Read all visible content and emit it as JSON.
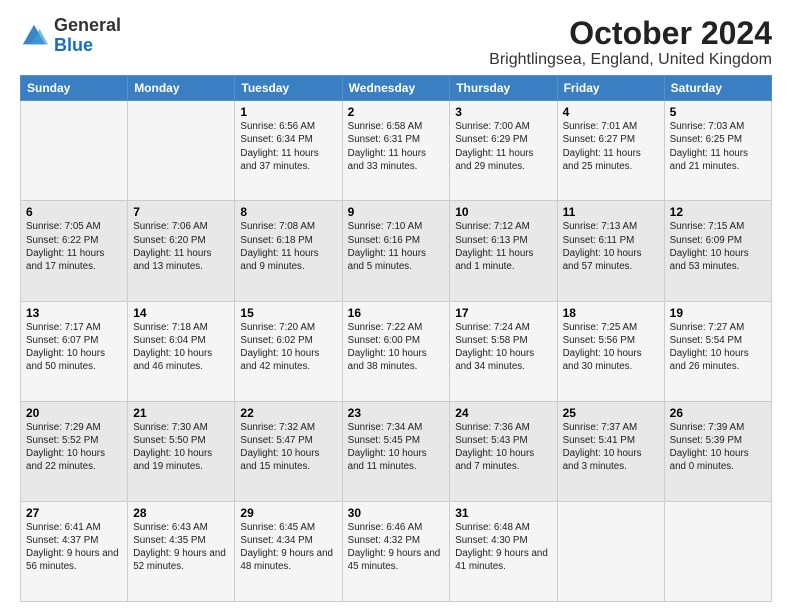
{
  "logo": {
    "general": "General",
    "blue": "Blue"
  },
  "header": {
    "title": "October 2024",
    "subtitle": "Brightlingsea, England, United Kingdom"
  },
  "weekdays": [
    "Sunday",
    "Monday",
    "Tuesday",
    "Wednesday",
    "Thursday",
    "Friday",
    "Saturday"
  ],
  "weeks": [
    [
      {
        "day": "",
        "info": ""
      },
      {
        "day": "",
        "info": ""
      },
      {
        "day": "1",
        "info": "Sunrise: 6:56 AM\nSunset: 6:34 PM\nDaylight: 11 hours and 37 minutes."
      },
      {
        "day": "2",
        "info": "Sunrise: 6:58 AM\nSunset: 6:31 PM\nDaylight: 11 hours and 33 minutes."
      },
      {
        "day": "3",
        "info": "Sunrise: 7:00 AM\nSunset: 6:29 PM\nDaylight: 11 hours and 29 minutes."
      },
      {
        "day": "4",
        "info": "Sunrise: 7:01 AM\nSunset: 6:27 PM\nDaylight: 11 hours and 25 minutes."
      },
      {
        "day": "5",
        "info": "Sunrise: 7:03 AM\nSunset: 6:25 PM\nDaylight: 11 hours and 21 minutes."
      }
    ],
    [
      {
        "day": "6",
        "info": "Sunrise: 7:05 AM\nSunset: 6:22 PM\nDaylight: 11 hours and 17 minutes."
      },
      {
        "day": "7",
        "info": "Sunrise: 7:06 AM\nSunset: 6:20 PM\nDaylight: 11 hours and 13 minutes."
      },
      {
        "day": "8",
        "info": "Sunrise: 7:08 AM\nSunset: 6:18 PM\nDaylight: 11 hours and 9 minutes."
      },
      {
        "day": "9",
        "info": "Sunrise: 7:10 AM\nSunset: 6:16 PM\nDaylight: 11 hours and 5 minutes."
      },
      {
        "day": "10",
        "info": "Sunrise: 7:12 AM\nSunset: 6:13 PM\nDaylight: 11 hours and 1 minute."
      },
      {
        "day": "11",
        "info": "Sunrise: 7:13 AM\nSunset: 6:11 PM\nDaylight: 10 hours and 57 minutes."
      },
      {
        "day": "12",
        "info": "Sunrise: 7:15 AM\nSunset: 6:09 PM\nDaylight: 10 hours and 53 minutes."
      }
    ],
    [
      {
        "day": "13",
        "info": "Sunrise: 7:17 AM\nSunset: 6:07 PM\nDaylight: 10 hours and 50 minutes."
      },
      {
        "day": "14",
        "info": "Sunrise: 7:18 AM\nSunset: 6:04 PM\nDaylight: 10 hours and 46 minutes."
      },
      {
        "day": "15",
        "info": "Sunrise: 7:20 AM\nSunset: 6:02 PM\nDaylight: 10 hours and 42 minutes."
      },
      {
        "day": "16",
        "info": "Sunrise: 7:22 AM\nSunset: 6:00 PM\nDaylight: 10 hours and 38 minutes."
      },
      {
        "day": "17",
        "info": "Sunrise: 7:24 AM\nSunset: 5:58 PM\nDaylight: 10 hours and 34 minutes."
      },
      {
        "day": "18",
        "info": "Sunrise: 7:25 AM\nSunset: 5:56 PM\nDaylight: 10 hours and 30 minutes."
      },
      {
        "day": "19",
        "info": "Sunrise: 7:27 AM\nSunset: 5:54 PM\nDaylight: 10 hours and 26 minutes."
      }
    ],
    [
      {
        "day": "20",
        "info": "Sunrise: 7:29 AM\nSunset: 5:52 PM\nDaylight: 10 hours and 22 minutes."
      },
      {
        "day": "21",
        "info": "Sunrise: 7:30 AM\nSunset: 5:50 PM\nDaylight: 10 hours and 19 minutes."
      },
      {
        "day": "22",
        "info": "Sunrise: 7:32 AM\nSunset: 5:47 PM\nDaylight: 10 hours and 15 minutes."
      },
      {
        "day": "23",
        "info": "Sunrise: 7:34 AM\nSunset: 5:45 PM\nDaylight: 10 hours and 11 minutes."
      },
      {
        "day": "24",
        "info": "Sunrise: 7:36 AM\nSunset: 5:43 PM\nDaylight: 10 hours and 7 minutes."
      },
      {
        "day": "25",
        "info": "Sunrise: 7:37 AM\nSunset: 5:41 PM\nDaylight: 10 hours and 3 minutes."
      },
      {
        "day": "26",
        "info": "Sunrise: 7:39 AM\nSunset: 5:39 PM\nDaylight: 10 hours and 0 minutes."
      }
    ],
    [
      {
        "day": "27",
        "info": "Sunrise: 6:41 AM\nSunset: 4:37 PM\nDaylight: 9 hours and 56 minutes."
      },
      {
        "day": "28",
        "info": "Sunrise: 6:43 AM\nSunset: 4:35 PM\nDaylight: 9 hours and 52 minutes."
      },
      {
        "day": "29",
        "info": "Sunrise: 6:45 AM\nSunset: 4:34 PM\nDaylight: 9 hours and 48 minutes."
      },
      {
        "day": "30",
        "info": "Sunrise: 6:46 AM\nSunset: 4:32 PM\nDaylight: 9 hours and 45 minutes."
      },
      {
        "day": "31",
        "info": "Sunrise: 6:48 AM\nSunset: 4:30 PM\nDaylight: 9 hours and 41 minutes."
      },
      {
        "day": "",
        "info": ""
      },
      {
        "day": "",
        "info": ""
      }
    ]
  ]
}
